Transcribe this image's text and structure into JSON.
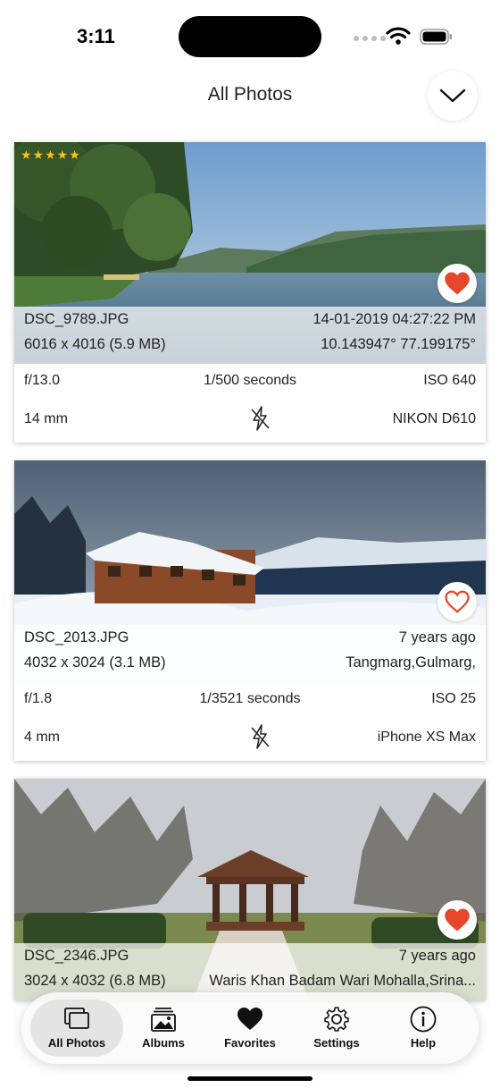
{
  "status": {
    "time": "3:11"
  },
  "header": {
    "title": "All Photos"
  },
  "photos": [
    {
      "rating": "★★★★★",
      "filename": "DSC_9789.JPG",
      "date": "14-01-2019 04:27:22 PM",
      "dimensions": "6016 x 4016 (5.9 MB)",
      "location": "10.143947° 77.199175°",
      "aperture": "f/13.0",
      "shutter": "1/500 seconds",
      "iso": "ISO 640",
      "focal": "14 mm",
      "camera": "NIKON D610",
      "favorite": true
    },
    {
      "rating": "",
      "filename": "DSC_2013.JPG",
      "date": "7 years ago",
      "dimensions": "4032 x 3024 (3.1 MB)",
      "location": "Tangmarg,Gulmarg,",
      "aperture": "f/1.8",
      "shutter": "1/3521 seconds",
      "iso": "ISO 25",
      "focal": "4 mm",
      "camera": "iPhone XS Max",
      "favorite": false
    },
    {
      "rating": "",
      "filename": "DSC_2346.JPG",
      "date": "7 years ago",
      "dimensions": "3024 x 4032 (6.8 MB)",
      "location": "Waris Khan Badam Wari Mohalla,Srina...",
      "favorite": true
    }
  ],
  "tabs": [
    {
      "label": "All Photos",
      "icon": "photos-stack-icon",
      "active": true
    },
    {
      "label": "Albums",
      "icon": "albums-icon",
      "active": false
    },
    {
      "label": "Favorites",
      "icon": "heart-icon",
      "active": false
    },
    {
      "label": "Settings",
      "icon": "gear-icon",
      "active": false
    },
    {
      "label": "Help",
      "icon": "info-icon",
      "active": false
    }
  ],
  "colors": {
    "accent_red": "#e8462a",
    "star_gold": "#f5c518"
  }
}
